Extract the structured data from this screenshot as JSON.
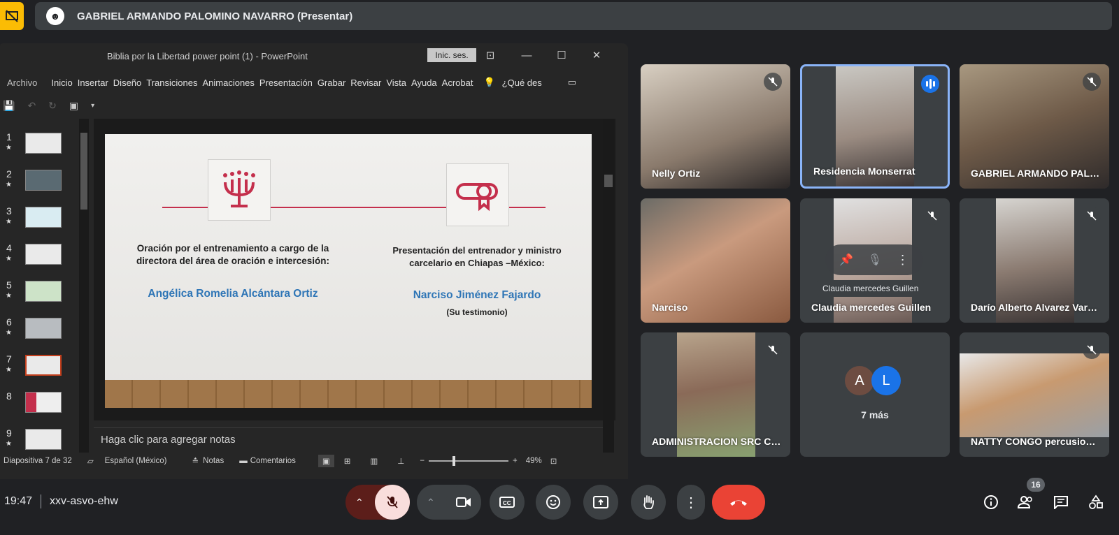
{
  "presenter": {
    "name": "GABRIEL ARMANDO PALOMINO NAVARRO (Presentar)"
  },
  "ppt": {
    "title": "Biblia por la Libertad power point (1)  -  PowerPoint",
    "signin": "Inic. ses.",
    "menu": [
      "Archivo",
      "Inicio",
      "Insertar",
      "Diseño",
      "Transiciones",
      "Animaciones",
      "Presentación",
      "Grabar",
      "Revisar",
      "Vista",
      "Ayuda",
      "Acrobat"
    ],
    "tell_me": "¿Qué des",
    "slides": [
      "1",
      "2",
      "3",
      "4",
      "5",
      "6",
      "7",
      "8",
      "9"
    ],
    "slide": {
      "left_heading_1": "Oración por el  entrenamiento a cargo de la",
      "left_heading_2": "directora  del área de  oración e intercesión:",
      "left_name": "Angélica Romelia Alcántara Ortiz",
      "right_heading_1": "Presentación del entrenador y ministro",
      "right_heading_2": "carcelario en Chiapas –México:",
      "right_name": "Narciso Jiménez Fajardo",
      "right_sub": "(Su testimonio)"
    },
    "notes_placeholder": "Haga clic para agregar notas",
    "status": {
      "slide_counter": "Diapositiva 7 de 32",
      "language": "Español (México)",
      "notes": "Notas",
      "comments": "Comentarios",
      "zoom": "49%"
    }
  },
  "tiles": [
    {
      "name": "Nelly Ortiz"
    },
    {
      "name": "Residencia Monserrat"
    },
    {
      "name": "GABRIEL ARMANDO PALOMINO NAVARRO"
    },
    {
      "name": "Narciso"
    },
    {
      "name": "Claudia mercedes Guillen",
      "tooltip": "Claudia mercedes Guillen"
    },
    {
      "name": "Darío Alberto Alvarez Vargas"
    },
    {
      "name": "ADMINISTRACION SRC COMUNICACIONES"
    },
    {
      "more": "7 más",
      "avatars": [
        "A",
        "L"
      ]
    },
    {
      "name": "NATTY CONGO percusiones"
    }
  ],
  "meeting": {
    "time": "19:47",
    "code": "xxv-asvo-ehw",
    "participants": "16"
  }
}
